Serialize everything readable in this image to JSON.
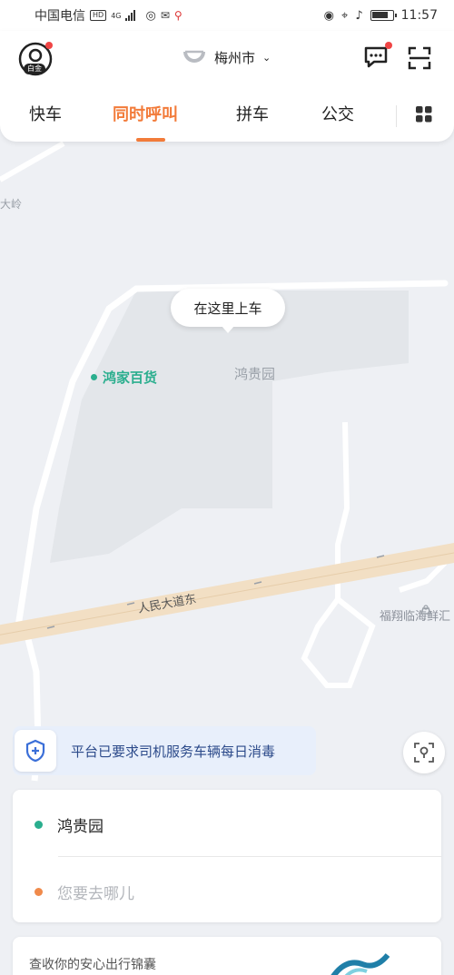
{
  "status_bar": {
    "carrier": "中国电信",
    "hd": "HD",
    "network": "4G",
    "time": "11:57",
    "battery_level": 0.8
  },
  "header": {
    "avatar_badge": "白金",
    "city": "梅州市",
    "tabs": [
      {
        "label": "快车",
        "active": false
      },
      {
        "label": "同时呼叫",
        "active": true
      },
      {
        "label": "拼车",
        "active": false
      },
      {
        "label": "公交",
        "active": false
      }
    ]
  },
  "map": {
    "edge_label": "大岭",
    "poi_green": "鸿家百货",
    "pickup_bubble": "在这里上车",
    "pin_label": "鸿贵园",
    "road_label": "人民大道东",
    "poi_right": "福翔临海鲜汇"
  },
  "safety_banner": "平台已要求司机服务车辆每日消毒",
  "address": {
    "pickup": "鸿贵园",
    "destination_placeholder": "您要去哪儿"
  },
  "bottom_card": {
    "text": "查收你的安心出行锦囊"
  },
  "colors": {
    "accent": "#f27b3a",
    "green": "#2aae8e",
    "banner_text": "#2c4a8a"
  }
}
